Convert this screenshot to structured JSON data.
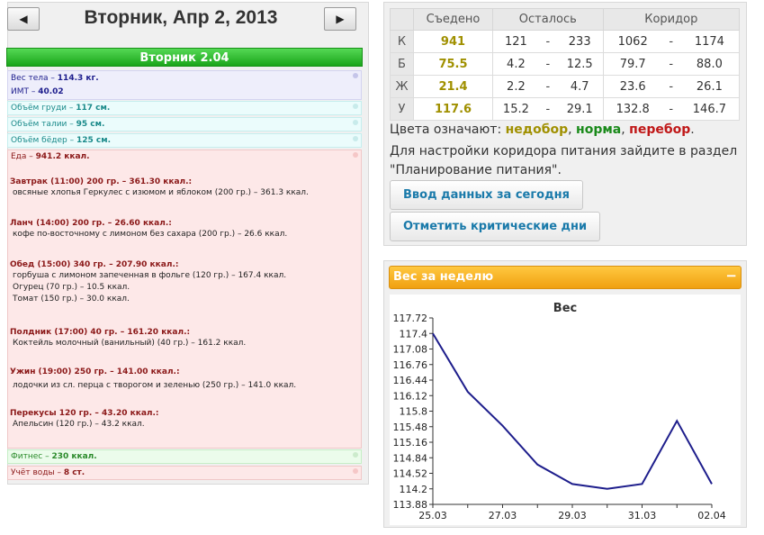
{
  "nav": {
    "prev": "◀",
    "next": "▶",
    "date_title": "Вторник, Апр 2, 2013"
  },
  "day": {
    "header": "Вторник 2.04",
    "weight_line": {
      "label": "Вес тела – ",
      "value": "114.3 кг."
    },
    "bmi_line": {
      "label": "ИМТ – ",
      "value": "40.02"
    },
    "measurements": [
      {
        "label": "Объём груди – ",
        "value": "117 см."
      },
      {
        "label": "Объём талии – ",
        "value": "95 см."
      },
      {
        "label": "Объём бёдер – ",
        "value": "125 см."
      }
    ],
    "food_total": {
      "label": "Еда – ",
      "value": "941.2 ккал."
    },
    "meals": [
      {
        "title": "Завтрак (11:00) 200 гр. – 361.30 ккал.:",
        "items": [
          "овсяные хлопья Геркулес с изюмом и яблоком (200 гр.) – 361.3 ккал."
        ]
      },
      {
        "title": "Ланч (14:00) 200 гр. – 26.60 ккал.:",
        "items": [
          "кофе по-восточному с лимоном без сахара (200 гр.) – 26.6 ккал."
        ]
      },
      {
        "title": "Обед (15:00) 340 гр. – 207.90 ккал.:",
        "items": [
          "горбуша с лимоном запеченная в фольге (120 гр.) – 167.4 ккал.",
          "Огурец (70 гр.) – 10.5 ккал.",
          "Томат (150 гр.) – 30.0 ккал."
        ]
      },
      {
        "title": "Полдник (17:00) 40 гр. – 161.20 ккал.:",
        "items": [
          "Коктейль молочный (ванильный) (40 гр.) – 161.2 ккал."
        ]
      },
      {
        "title": "Ужин (19:00) 250 гр. – 141.00 ккал.:",
        "items": [
          "лодочки из сл. перца с творогом и зеленью (250 гр.) – 141.0 ккал."
        ]
      },
      {
        "title": "Перекусы 120 гр. – 43.20 ккал.:",
        "items": [
          "Апельсин (120 гр.) – 43.2 ккал."
        ]
      }
    ],
    "fitness": {
      "label": "Фитнес – ",
      "value": "230 ккал."
    },
    "water": {
      "label": "Учёт воды – ",
      "value": "8 ст."
    }
  },
  "norms": {
    "headers": [
      "Съедено",
      "Осталось",
      "Коридор"
    ],
    "rows": [
      {
        "key": "К",
        "eaten": "941",
        "left_lo": "121",
        "left_hi": "233",
        "cor_lo": "1062",
        "cor_hi": "1174"
      },
      {
        "key": "Б",
        "eaten": "75.5",
        "left_lo": "4.2",
        "left_hi": "12.5",
        "cor_lo": "79.7",
        "cor_hi": "88.0"
      },
      {
        "key": "Ж",
        "eaten": "21.4",
        "left_lo": "2.2",
        "left_hi": "4.7",
        "cor_lo": "23.6",
        "cor_hi": "26.1"
      },
      {
        "key": "У",
        "eaten": "117.6",
        "left_lo": "15.2",
        "left_hi": "29.1",
        "cor_lo": "132.8",
        "cor_hi": "146.7"
      }
    ],
    "dash": "-",
    "legend": {
      "prefix": "Цвета означают: ",
      "under": "недобор",
      "norm": "норма",
      "over": "перебор",
      "comma": ", ",
      "dot": "."
    },
    "hint": "Для настройки коридора питания зайдите в раздел \"Планирование питания\".",
    "buttons": {
      "enter_today": "Ввод данных за сегодня",
      "critical_days": "Отметить критические дни"
    }
  },
  "weight_panel": {
    "title": "Вес за неделю",
    "collapse": "−"
  },
  "chart_data": {
    "type": "line",
    "title": "Вес",
    "x": [
      "25.03",
      "26.03",
      "27.03",
      "28.03",
      "29.03",
      "30.03",
      "31.03",
      "01.04",
      "02.04"
    ],
    "x_tick_labels": [
      "25.03",
      "27.03",
      "29.03",
      "31.03",
      "02.04"
    ],
    "values": [
      117.4,
      116.2,
      115.5,
      114.7,
      114.3,
      114.2,
      114.3,
      115.6,
      114.3
    ],
    "ylim": [
      113.88,
      117.72
    ],
    "y_ticks": [
      "117.72",
      "117.4",
      "117.08",
      "116.76",
      "116.44",
      "116.12",
      "115.8",
      "115.48",
      "115.16",
      "114.84",
      "114.52",
      "114.2",
      "113.88"
    ],
    "line_color": "#1e1e8c",
    "grid": false
  }
}
